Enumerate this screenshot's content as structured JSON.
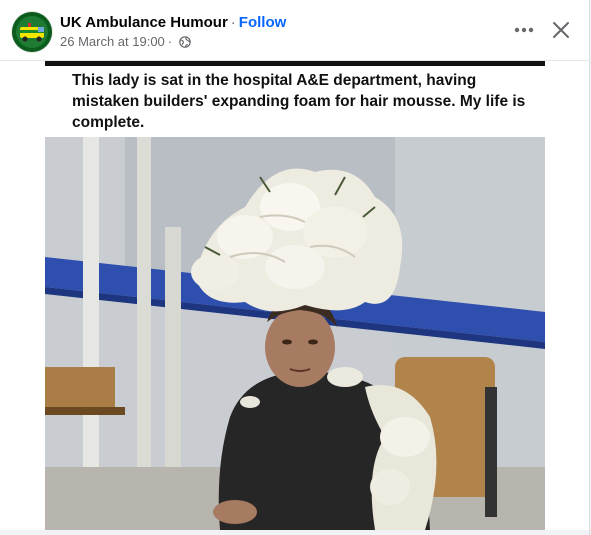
{
  "post": {
    "page_name": "UK Ambulance Humour",
    "separator": "·",
    "follow_label": "Follow",
    "timestamp": "26 March at 19:00",
    "meta_separator": "·",
    "audience_icon": "globe-icon"
  },
  "actions": {
    "more_icon": "more-horizontal-icon",
    "close_icon": "close-icon"
  },
  "media": {
    "caption": "This lady is sat in the hospital A&E department, having mistaken builders' expanding foam for hair mousse.  My life is complete."
  },
  "colors": {
    "accent": "#0866ff",
    "secondary_text": "#65676b",
    "primary_text": "#050505"
  }
}
